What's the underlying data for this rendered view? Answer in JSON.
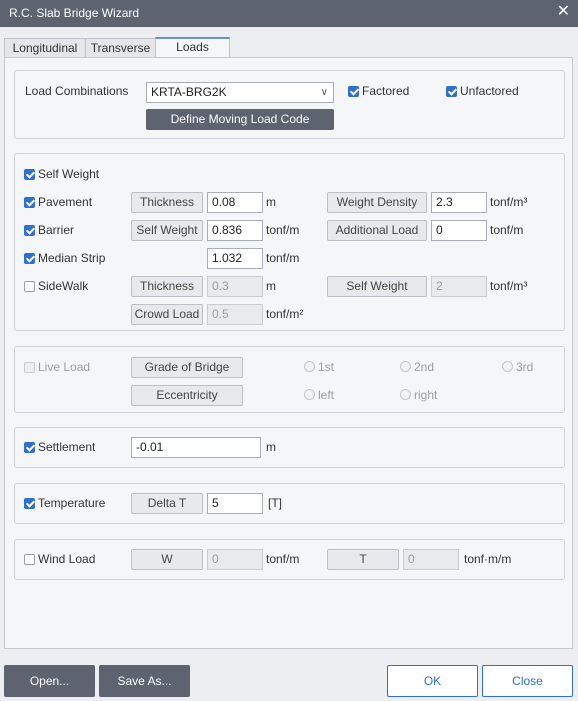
{
  "window": {
    "title": "R.C. Slab Bridge Wizard",
    "close_glyph": "✕"
  },
  "tabs": [
    "Longitudinal",
    "Transverse",
    "Loads"
  ],
  "load_combinations": {
    "label": "Load Combinations",
    "value": "KRTA-BRG2K",
    "factored": "Factored",
    "unfactored": "Unfactored",
    "define_button": "Define Moving Load Code"
  },
  "dead_loads": {
    "self_weight": "Self Weight",
    "pavement": {
      "label": "Pavement",
      "thickness_btn": "Thickness",
      "thickness": "0.08",
      "thickness_unit": "m",
      "density_btn": "Weight Density",
      "density": "2.3",
      "density_unit": "tonf/m³"
    },
    "barrier": {
      "label": "Barrier",
      "self_weight_btn": "Self Weight",
      "self_weight": "0.836",
      "self_weight_unit": "tonf/m",
      "additional_btn": "Additional Load",
      "additional": "0",
      "additional_unit": "tonf/m"
    },
    "median": {
      "label": "Median Strip",
      "value": "1.032",
      "unit": "tonf/m"
    },
    "sidewalk": {
      "label": "SideWalk",
      "thickness_btn": "Thickness",
      "thickness": "0.3",
      "thickness_unit": "m",
      "self_weight_btn": "Self Weight",
      "self_weight": "2",
      "self_weight_unit": "tonf/m³",
      "crowd_btn": "Crowd Load",
      "crowd": "0.5",
      "crowd_unit": "tonf/m²"
    }
  },
  "live_load": {
    "label": "Live Load",
    "grade_btn": "Grade of Bridge",
    "ecc_btn": "Eccentricity",
    "grades": [
      "1st",
      "2nd",
      "3rd"
    ],
    "sides": [
      "left",
      "right"
    ]
  },
  "settlement": {
    "label": "Settlement",
    "value": "-0.01",
    "unit": "m"
  },
  "temperature": {
    "label": "Temperature",
    "btn": "Delta T",
    "value": "5",
    "unit": "[T]"
  },
  "wind": {
    "label": "Wind Load",
    "w_btn": "W",
    "w_value": "0",
    "w_unit": "tonf/m",
    "t_btn": "T",
    "t_value": "0",
    "t_unit": "tonf·m/m"
  },
  "footer": {
    "open": "Open...",
    "save_as": "Save As...",
    "ok": "OK",
    "close": "Close"
  }
}
